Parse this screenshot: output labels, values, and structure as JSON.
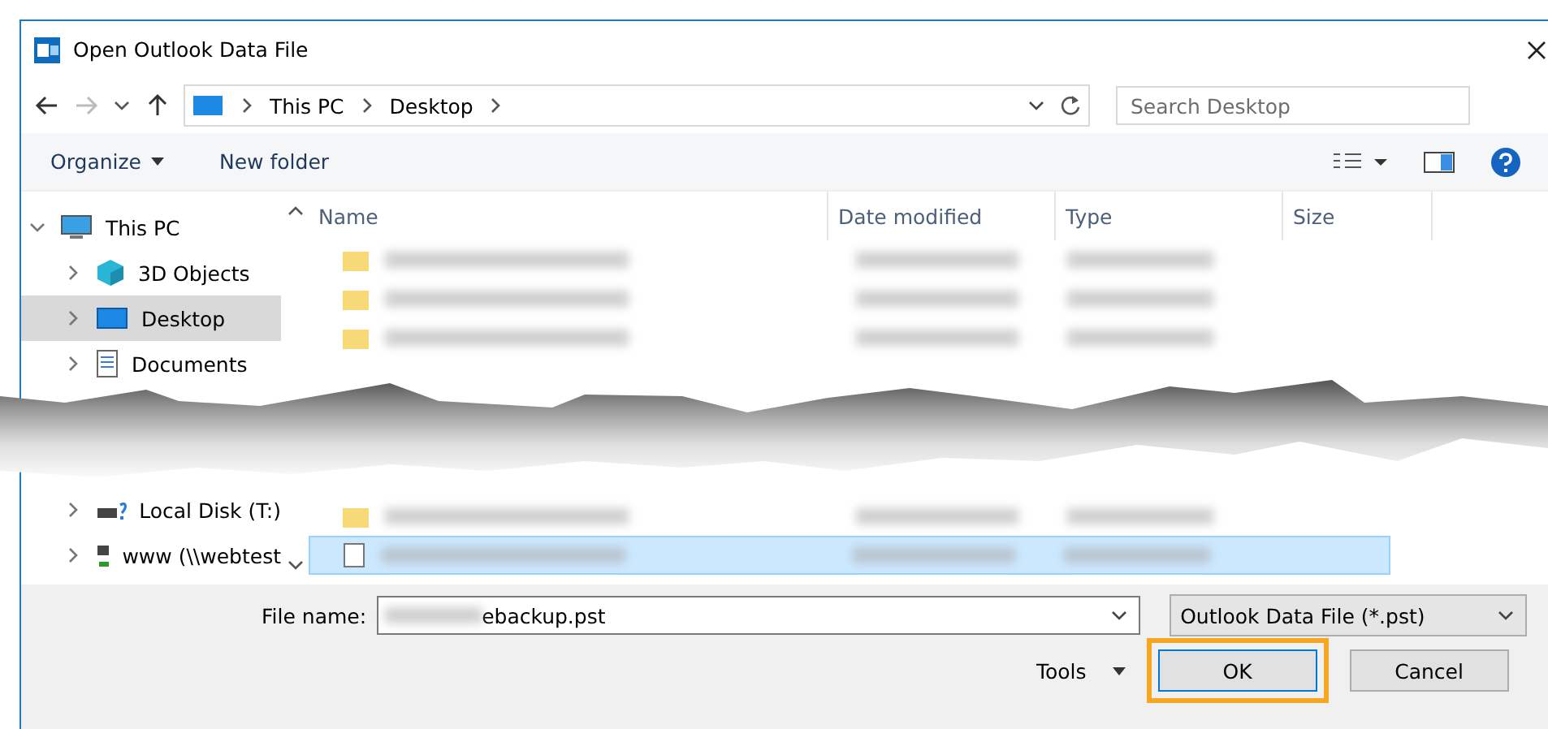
{
  "window": {
    "title": "Open Outlook Data File"
  },
  "address": {
    "path": [
      "This PC",
      "Desktop"
    ]
  },
  "search": {
    "placeholder": "Search Desktop"
  },
  "toolbar": {
    "items": [
      {
        "label": "Organize",
        "kind": "menu"
      },
      {
        "label": "New folder",
        "kind": "plain"
      }
    ]
  },
  "sidebar": {
    "items": [
      {
        "label": "This PC",
        "kind": "computer",
        "expanded": true,
        "selected": false,
        "children": [
          {
            "label": "3D Objects",
            "kind": "objects",
            "expanded": false,
            "selected": false
          },
          {
            "label": "Desktop",
            "kind": "desktop",
            "expanded": false,
            "selected": true
          },
          {
            "label": "Documents",
            "kind": "documents",
            "expanded": false,
            "selected": false
          },
          {
            "label": "Local Disk (T:)",
            "kind": "drive",
            "expanded": false,
            "selected": false
          },
          {
            "label": "www (\\\\webtest",
            "kind": "network",
            "expanded": false,
            "selected": false
          }
        ]
      }
    ]
  },
  "table": {
    "columns": [
      "Name",
      "Date modified",
      "Type",
      "Size"
    ],
    "rows": [
      {
        "kind": "folder",
        "selected": false
      },
      {
        "kind": "folder",
        "selected": false
      },
      {
        "kind": "folder",
        "selected": false
      },
      {
        "kind": "folder",
        "selected": false
      },
      {
        "kind": "file",
        "selected": true
      }
    ]
  },
  "footer": {
    "file_name_label": "File name:",
    "file_name_value": "ebackup.pst",
    "filter": "Outlook Data File (*.pst)",
    "tools": "Tools",
    "buttons": [
      {
        "label": "OK",
        "focused": true
      },
      {
        "label": "Cancel",
        "focused": false
      }
    ]
  }
}
